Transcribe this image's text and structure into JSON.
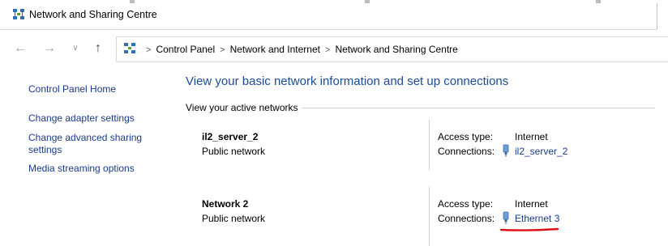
{
  "window": {
    "title": "Network and Sharing Centre"
  },
  "nav": {
    "back_icon": "back-arrow-icon",
    "forward_icon": "forward-arrow-icon",
    "recent_icon": "chevron-down-icon",
    "up_icon": "up-arrow-icon",
    "breadcrumbs": [
      "Control Panel",
      "Network and Internet",
      "Network and Sharing Centre"
    ]
  },
  "sidebar": {
    "items": [
      {
        "label": "Control Panel Home"
      },
      {
        "label": "Change adapter settings"
      },
      {
        "label": "Change advanced sharing settings"
      },
      {
        "label": "Media streaming options"
      }
    ]
  },
  "main": {
    "title": "View your basic network information and set up connections",
    "active_networks_header": "View your active networks",
    "networks": [
      {
        "name": "il2_server_2",
        "category": "Public network",
        "access_type_label": "Access type:",
        "access_type": "Internet",
        "connections_label": "Connections:",
        "connection": "il2_server_2"
      },
      {
        "name": "Network 2",
        "category": "Public network",
        "access_type_label": "Access type:",
        "access_type": "Internet",
        "connections_label": "Connections:",
        "connection": "Ethernet 3"
      }
    ]
  },
  "colors": {
    "link": "#1a3a8c",
    "title": "#1c4a9a",
    "annotation_red": "#e0101b"
  }
}
